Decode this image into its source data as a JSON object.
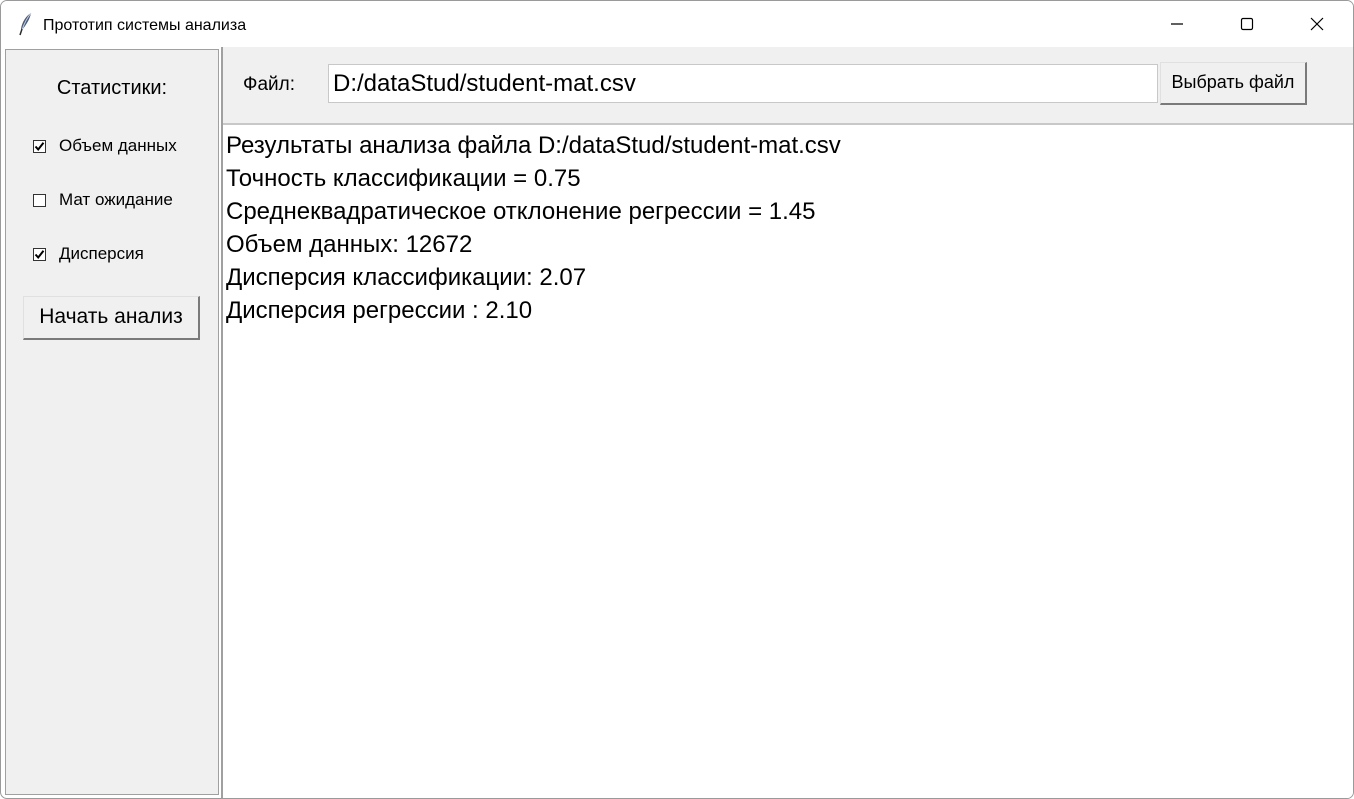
{
  "window": {
    "title": "Прототип системы анализа"
  },
  "sidebar": {
    "stats_label": "Статистики:",
    "checkboxes": [
      {
        "label": "Объем данных",
        "checked": true
      },
      {
        "label": "Мат ожидание",
        "checked": false
      },
      {
        "label": "Дисперсия",
        "checked": true
      }
    ],
    "start_button": "Начать анализ"
  },
  "file_bar": {
    "label": "Файл:",
    "path_value": "D:/dataStud/student-mat.csv",
    "choose_button": "Выбрать файл"
  },
  "results": [
    "Результаты анализа файла D:/dataStud/student-mat.csv",
    "Точность классификации = 0.75",
    "Среднеквадратическое отклонение регрессии = 1.45",
    "Объем данных: 12672",
    "Дисперсия классификации: 2.07",
    "Дисперсия регрессии : 2.10"
  ]
}
